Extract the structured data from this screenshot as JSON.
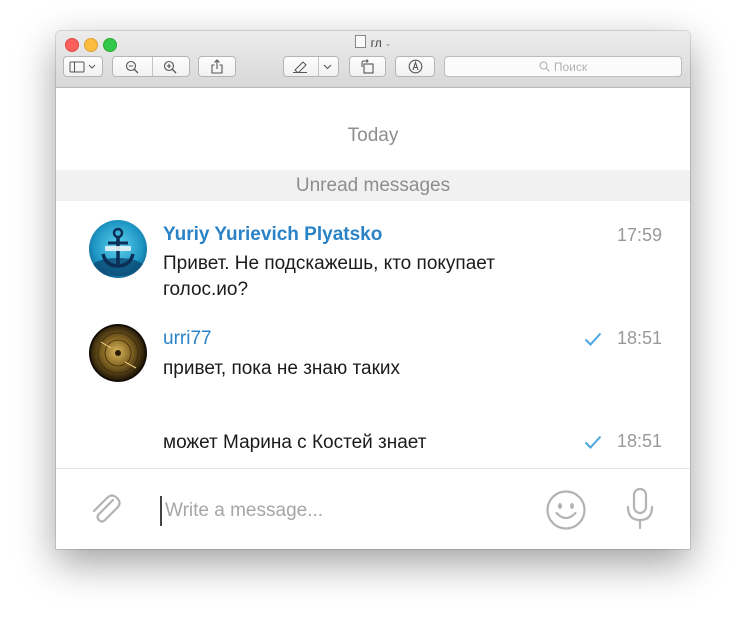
{
  "window": {
    "title": "гл"
  },
  "toolbar": {
    "search_placeholder": "Поиск"
  },
  "chat": {
    "date_separator": "Today",
    "unread_label": "Unread messages",
    "messages": [
      {
        "sender": "Yuriy Yurievich Plyatsko",
        "text": "Привет. Не подскажешь, кто покупает голос.ио?",
        "time": "17:59",
        "read": false
      },
      {
        "sender": "urri77",
        "text": "привет, пока не знаю таких",
        "time": "18:51",
        "read": true
      },
      {
        "sender": "",
        "text": "может Марина с Костей знает",
        "time": "18:51",
        "read": true
      }
    ]
  },
  "composer": {
    "placeholder": "Write a message..."
  },
  "colors": {
    "accent": "#2a83c7",
    "check": "#4ca5e0",
    "unread_bar": "#f1f1f1"
  },
  "icons": [
    "attach-icon",
    "emoji-icon",
    "microphone-icon",
    "search-icon",
    "read-check-icon"
  ]
}
